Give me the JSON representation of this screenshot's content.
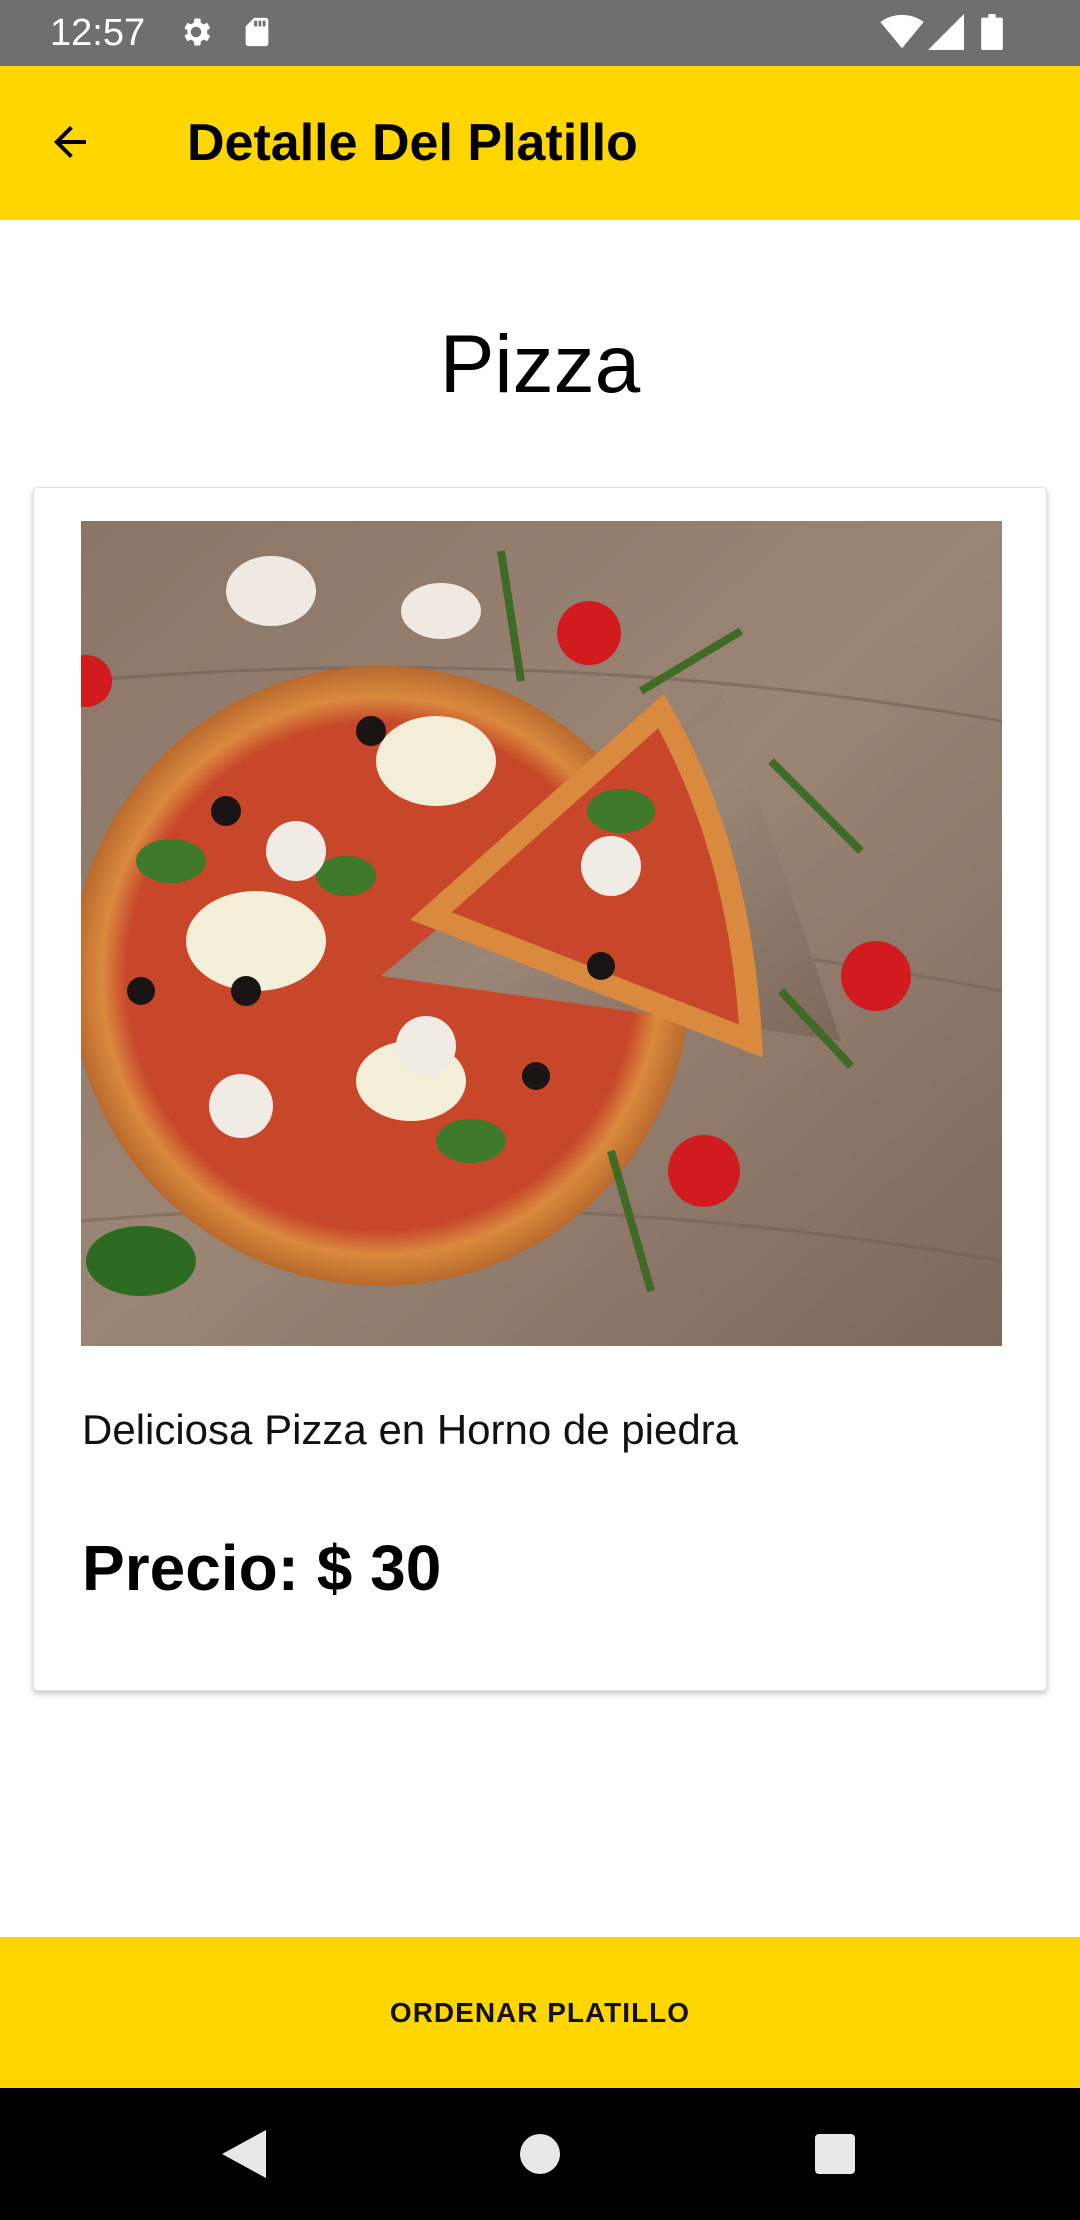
{
  "status_bar": {
    "time": "12:57",
    "icons": [
      "gear-icon",
      "sd-card-icon",
      "wifi-icon",
      "signal-icon",
      "battery-icon"
    ]
  },
  "app_bar": {
    "title": "Detalle Del Platillo",
    "back_icon": "arrow-back-icon",
    "background": "#ffd600"
  },
  "dish": {
    "name": "Pizza",
    "image_icon": "pizza-photo",
    "description": "Deliciosa Pizza en Horno de piedra",
    "price_label": "Precio: $ 30"
  },
  "order_button": {
    "label": "ORDENAR PLATILLO",
    "background": "#ffd600"
  },
  "nav_bar": {
    "icons": [
      "back-triangle-icon",
      "home-circle-icon",
      "recents-square-icon"
    ]
  }
}
